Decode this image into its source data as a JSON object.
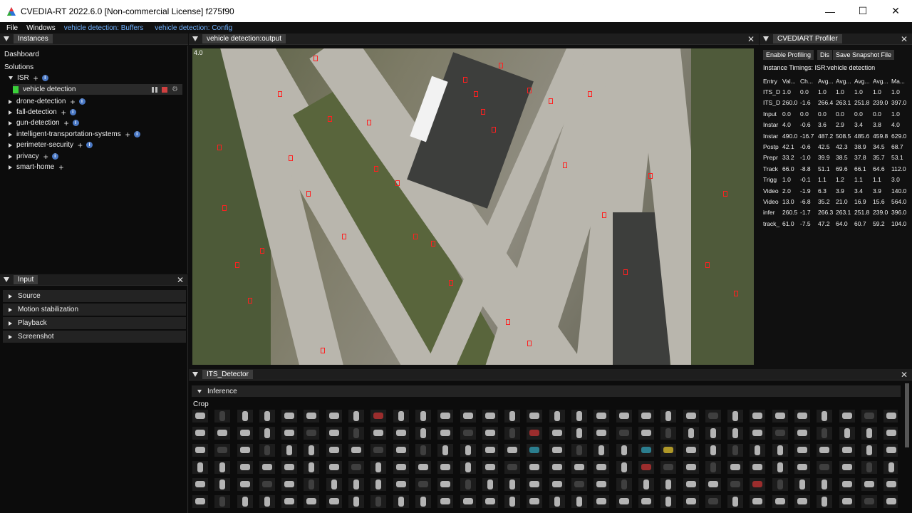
{
  "window": {
    "title": "CVEDIA-RT 2022.6.0    [Non-commercial License] f275f90",
    "min_glyph": "—",
    "max_glyph": "☐",
    "close_glyph": "✕"
  },
  "menu": {
    "file": "File",
    "windows": "Windows",
    "buffers": "vehicle detection: Buffers",
    "config": "vehicle detection: Config"
  },
  "instances": {
    "tab": "Instances",
    "dashboard": "Dashboard",
    "solutions": "Solutions",
    "isr": "ISR",
    "selected": "vehicle detection",
    "items": [
      "drone-detection",
      "fall-detection",
      "gun-detection",
      "intelligent-transportation-systems",
      "perimeter-security",
      "privacy",
      "smart-home"
    ]
  },
  "input": {
    "tab": "Input",
    "rows": [
      "Source",
      "Motion stabilization",
      "Playback",
      "Screenshot"
    ]
  },
  "viewport": {
    "tab": "vehicle detection:output",
    "overlay": "4.0"
  },
  "profiler": {
    "tab": "CVEDIART Profiler",
    "enable": "Enable Profiling",
    "dis": "Dis",
    "save": "Save Snapshot File",
    "timings_label": "Instance Timings: ISR:vehicle detection",
    "headers": [
      "Entry",
      "Val...",
      "Ch...",
      "Avg...",
      "Avg...",
      "Avg...",
      "Avg...",
      "Ma..."
    ],
    "rows": [
      [
        "ITS_D",
        "1.0",
        "0.0",
        "1.0",
        "1.0",
        "1.0",
        "1.0",
        "1.0"
      ],
      [
        "ITS_D",
        "260.0",
        "-1.6",
        "266.4",
        "263.1",
        "251.8",
        "239.0",
        "397.0"
      ],
      [
        "Input",
        "0.0",
        "0.0",
        "0.0",
        "0.0",
        "0.0",
        "0.0",
        "1.0"
      ],
      [
        "Instar",
        "4.0",
        "-0.6",
        "3.6",
        "2.9",
        "3.4",
        "3.8",
        "4.0"
      ],
      [
        "Instar",
        "490.0",
        "-16.7",
        "487.2",
        "508.5",
        "485.6",
        "459.8",
        "629.0"
      ],
      [
        "Postp",
        "42.1",
        "-0.6",
        "42.5",
        "42.3",
        "38.9",
        "34.5",
        "68.7"
      ],
      [
        "Prepr",
        "33.2",
        "-1.0",
        "39.9",
        "38.5",
        "37.8",
        "35.7",
        "53.1"
      ],
      [
        "Track",
        "66.0",
        "-8.8",
        "51.1",
        "69.6",
        "66.1",
        "64.6",
        "112.0"
      ],
      [
        "Trigg",
        "1.0",
        "-0.1",
        "1.1",
        "1.2",
        "1.1",
        "1.1",
        "3.0"
      ],
      [
        "Video",
        "2.0",
        "-1.9",
        "6.3",
        "3.9",
        "3.4",
        "3.9",
        "140.0"
      ],
      [
        "Video",
        "13.0",
        "-6.8",
        "35.2",
        "21.0",
        "16.9",
        "15.6",
        "564.0"
      ],
      [
        "infer",
        "260.5",
        "-1.7",
        "266.3",
        "263.1",
        "251.8",
        "239.0",
        "396.0"
      ],
      [
        "track_",
        "61.0",
        "-7.5",
        "47.2",
        "64.0",
        "60.7",
        "59.2",
        "104.0"
      ]
    ]
  },
  "its": {
    "tab": "ITS_Detector",
    "inference": "Inference",
    "crop": "Crop"
  }
}
